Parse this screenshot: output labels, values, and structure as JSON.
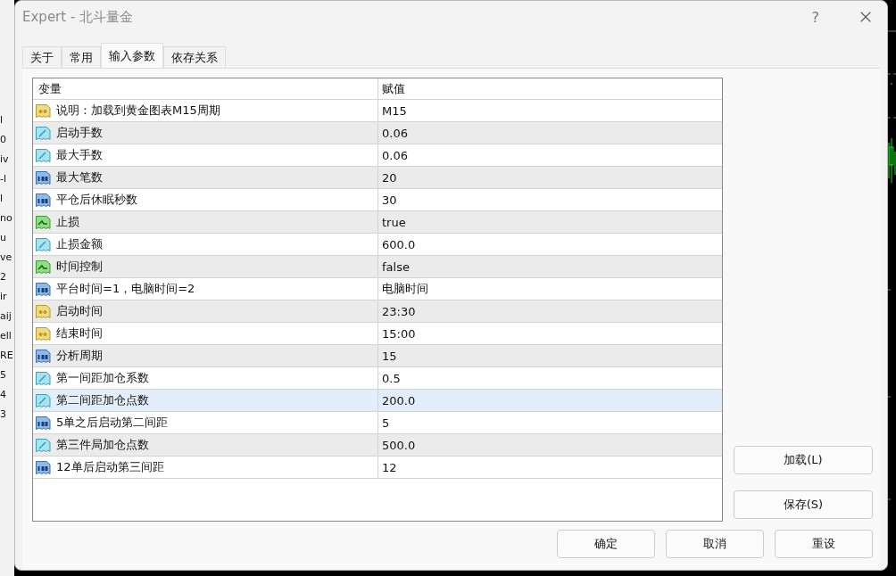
{
  "background_left_text": [
    "l",
    "0",
    "iv",
    "-l",
    "l",
    "no",
    "u",
    "ve",
    "2",
    "ir",
    "aij",
    "ell",
    "RE",
    "5",
    "4",
    "3"
  ],
  "window": {
    "title": "Expert - 北斗量金",
    "help": "?"
  },
  "tabs": [
    {
      "label": "关于",
      "selected": false
    },
    {
      "label": "常用",
      "selected": false
    },
    {
      "label": "输入参数",
      "selected": true
    },
    {
      "label": "依存关系",
      "selected": false
    }
  ],
  "table": {
    "columns": [
      "变量",
      "赋值"
    ],
    "rows": [
      {
        "kind": "string",
        "name": "说明：加载到黄金图表M15周期",
        "value": "M15",
        "selected": false
      },
      {
        "kind": "double",
        "name": "启动手数",
        "value": "0.06",
        "selected": false
      },
      {
        "kind": "double",
        "name": "最大手数",
        "value": "0.06",
        "selected": false
      },
      {
        "kind": "int",
        "name": "最大笔数",
        "value": "20",
        "selected": false
      },
      {
        "kind": "int",
        "name": "平仓后休眠秒数",
        "value": "30",
        "selected": false
      },
      {
        "kind": "bool",
        "name": "止损",
        "value": "true",
        "selected": false
      },
      {
        "kind": "double",
        "name": "止损金额",
        "value": "600.0",
        "selected": false
      },
      {
        "kind": "bool",
        "name": "时间控制",
        "value": "false",
        "selected": false
      },
      {
        "kind": "int",
        "name": "平台时间=1，电脑时间=2",
        "value": "电脑时间",
        "selected": false
      },
      {
        "kind": "string",
        "name": "启动时间",
        "value": "23:30",
        "selected": false
      },
      {
        "kind": "string",
        "name": "结束时间",
        "value": "15:00",
        "selected": false
      },
      {
        "kind": "int",
        "name": "分析周期",
        "value": "15",
        "selected": false
      },
      {
        "kind": "double",
        "name": "第一间距加仓系数",
        "value": "0.5",
        "selected": false
      },
      {
        "kind": "double",
        "name": "第二间距加仓点数",
        "value": "200.0",
        "selected": true
      },
      {
        "kind": "int",
        "name": "5单之后启动第二间距",
        "value": "5",
        "selected": false
      },
      {
        "kind": "double",
        "name": "第三件局加仓点数",
        "value": "500.0",
        "selected": false
      },
      {
        "kind": "int",
        "name": "12单后启动第三间距",
        "value": "12",
        "selected": false
      }
    ]
  },
  "side_buttons": [
    "加载(L)",
    "保存(S)"
  ],
  "buttons": [
    "确定",
    "取消",
    "重设"
  ]
}
